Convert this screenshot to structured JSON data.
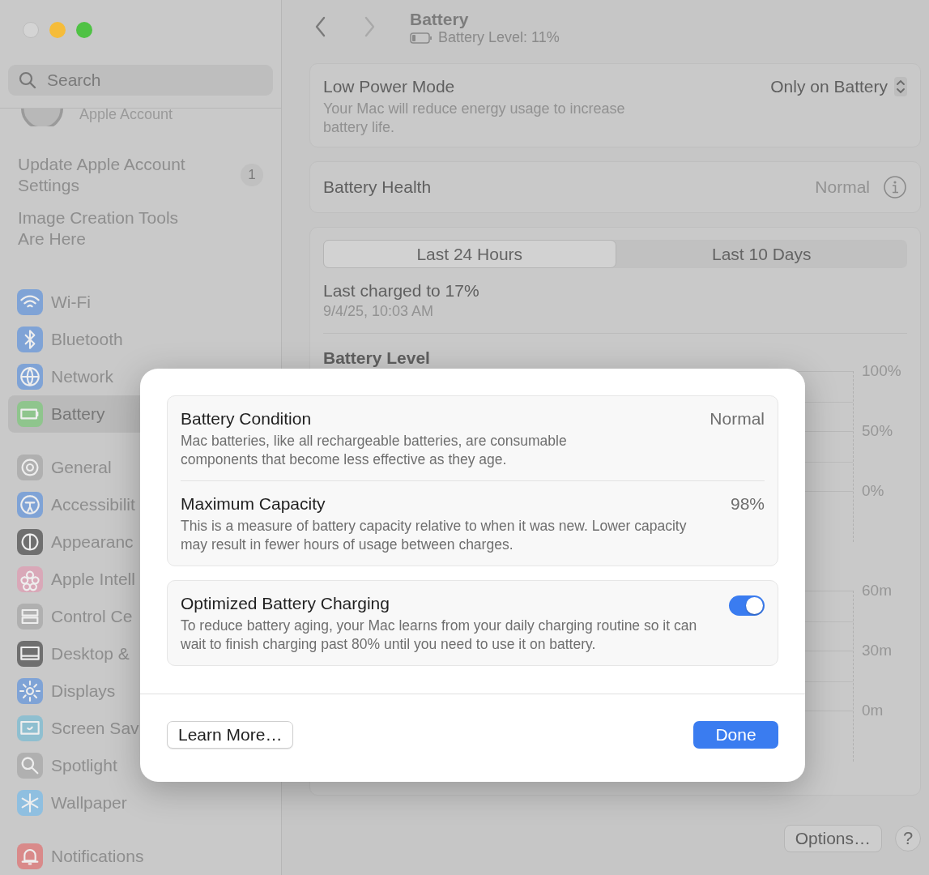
{
  "sidebar": {
    "search": {
      "placeholder": "Search"
    },
    "account": {
      "label": "Apple Account"
    },
    "notices": [
      {
        "text": "Update Apple Account Settings",
        "badge": "1"
      },
      {
        "text": "Image Creation Tools Are Here"
      }
    ],
    "groups": [
      [
        {
          "label": "Wi-Fi",
          "color": "#7fa3d6",
          "selected": false
        },
        {
          "label": "Bluetooth",
          "color": "#7fa3d6",
          "selected": false
        },
        {
          "label": "Network",
          "color": "#7fa3d6",
          "selected": false
        },
        {
          "label": "Battery",
          "color": "#8fc58d",
          "selected": true
        }
      ],
      [
        {
          "label": "General",
          "color": "#b0b0b0",
          "selected": false
        },
        {
          "label": "Accessibilit",
          "color": "#7fa3d6",
          "selected": false
        },
        {
          "label": "Appearanc",
          "color": "#6f6f6f",
          "selected": false
        },
        {
          "label": "Apple Intell",
          "color": "#d9a8b8",
          "selected": false
        },
        {
          "label": "Control Ce",
          "color": "#b0b0b0",
          "selected": false
        },
        {
          "label": "Desktop &",
          "color": "#6f6f6f",
          "selected": false
        },
        {
          "label": "Displays",
          "color": "#7fa3d6",
          "selected": false
        },
        {
          "label": "Screen Sav",
          "color": "#8fbfd0",
          "selected": false
        },
        {
          "label": "Spotlight",
          "color": "#b0b0b0",
          "selected": false
        },
        {
          "label": "Wallpaper",
          "color": "#8fbfe0",
          "selected": false
        }
      ],
      [
        {
          "label": "Notifications",
          "color": "#d98a8a",
          "selected": false
        }
      ]
    ]
  },
  "header": {
    "title": "Battery",
    "subtitle": "Battery Level: 11%"
  },
  "low_power": {
    "title": "Low Power Mode",
    "description": "Your Mac will reduce energy usage to increase battery life.",
    "value": "Only on Battery"
  },
  "battery_health": {
    "label": "Battery Health",
    "value": "Normal"
  },
  "usage": {
    "tabs": [
      {
        "label": "Last 24 Hours",
        "selected": true
      },
      {
        "label": "Last 10 Days",
        "selected": false
      }
    ],
    "last_charged": "Last charged to 17%",
    "last_charged_time": "9/4/25, 10:03 AM",
    "level_chart": {
      "title": "Battery Level",
      "y_ticks": [
        "100%",
        "50%",
        "0%"
      ]
    },
    "activity_chart": {
      "y_ticks": [
        "60m",
        "30m",
        "0m"
      ]
    }
  },
  "footer": {
    "options": "Options…",
    "help": "?"
  },
  "dialog": {
    "rows": [
      {
        "title": "Battery Condition",
        "value": "Normal",
        "description": "Mac batteries, like all rechargeable batteries, are consumable components that become less effective as they age."
      },
      {
        "title": "Maximum Capacity",
        "value": "98%",
        "description": "This is a measure of battery capacity relative to when it was new. Lower capacity may result in fewer hours of usage between charges."
      }
    ],
    "charging": {
      "title": "Optimized Battery Charging",
      "on": true,
      "description": "To reduce battery aging, your Mac learns from your daily charging routine so it can wait to finish charging past 80% until you need to use it on battery."
    },
    "learn_more": "Learn More…",
    "done": "Done"
  }
}
